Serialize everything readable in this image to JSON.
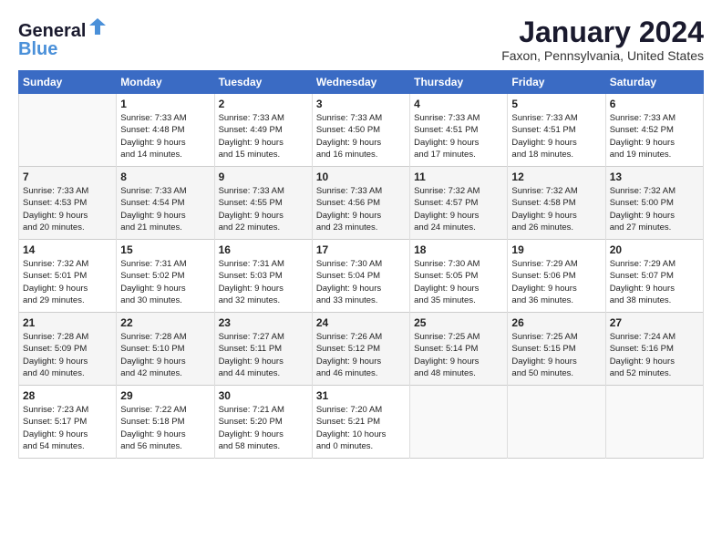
{
  "logo": {
    "line1": "General",
    "line2": "Blue"
  },
  "title": "January 2024",
  "subtitle": "Faxon, Pennsylvania, United States",
  "days_header": [
    "Sunday",
    "Monday",
    "Tuesday",
    "Wednesday",
    "Thursday",
    "Friday",
    "Saturday"
  ],
  "weeks": [
    [
      {
        "num": "",
        "info": ""
      },
      {
        "num": "1",
        "info": "Sunrise: 7:33 AM\nSunset: 4:48 PM\nDaylight: 9 hours\nand 14 minutes."
      },
      {
        "num": "2",
        "info": "Sunrise: 7:33 AM\nSunset: 4:49 PM\nDaylight: 9 hours\nand 15 minutes."
      },
      {
        "num": "3",
        "info": "Sunrise: 7:33 AM\nSunset: 4:50 PM\nDaylight: 9 hours\nand 16 minutes."
      },
      {
        "num": "4",
        "info": "Sunrise: 7:33 AM\nSunset: 4:51 PM\nDaylight: 9 hours\nand 17 minutes."
      },
      {
        "num": "5",
        "info": "Sunrise: 7:33 AM\nSunset: 4:51 PM\nDaylight: 9 hours\nand 18 minutes."
      },
      {
        "num": "6",
        "info": "Sunrise: 7:33 AM\nSunset: 4:52 PM\nDaylight: 9 hours\nand 19 minutes."
      }
    ],
    [
      {
        "num": "7",
        "info": "Sunrise: 7:33 AM\nSunset: 4:53 PM\nDaylight: 9 hours\nand 20 minutes."
      },
      {
        "num": "8",
        "info": "Sunrise: 7:33 AM\nSunset: 4:54 PM\nDaylight: 9 hours\nand 21 minutes."
      },
      {
        "num": "9",
        "info": "Sunrise: 7:33 AM\nSunset: 4:55 PM\nDaylight: 9 hours\nand 22 minutes."
      },
      {
        "num": "10",
        "info": "Sunrise: 7:33 AM\nSunset: 4:56 PM\nDaylight: 9 hours\nand 23 minutes."
      },
      {
        "num": "11",
        "info": "Sunrise: 7:32 AM\nSunset: 4:57 PM\nDaylight: 9 hours\nand 24 minutes."
      },
      {
        "num": "12",
        "info": "Sunrise: 7:32 AM\nSunset: 4:58 PM\nDaylight: 9 hours\nand 26 minutes."
      },
      {
        "num": "13",
        "info": "Sunrise: 7:32 AM\nSunset: 5:00 PM\nDaylight: 9 hours\nand 27 minutes."
      }
    ],
    [
      {
        "num": "14",
        "info": "Sunrise: 7:32 AM\nSunset: 5:01 PM\nDaylight: 9 hours\nand 29 minutes."
      },
      {
        "num": "15",
        "info": "Sunrise: 7:31 AM\nSunset: 5:02 PM\nDaylight: 9 hours\nand 30 minutes."
      },
      {
        "num": "16",
        "info": "Sunrise: 7:31 AM\nSunset: 5:03 PM\nDaylight: 9 hours\nand 32 minutes."
      },
      {
        "num": "17",
        "info": "Sunrise: 7:30 AM\nSunset: 5:04 PM\nDaylight: 9 hours\nand 33 minutes."
      },
      {
        "num": "18",
        "info": "Sunrise: 7:30 AM\nSunset: 5:05 PM\nDaylight: 9 hours\nand 35 minutes."
      },
      {
        "num": "19",
        "info": "Sunrise: 7:29 AM\nSunset: 5:06 PM\nDaylight: 9 hours\nand 36 minutes."
      },
      {
        "num": "20",
        "info": "Sunrise: 7:29 AM\nSunset: 5:07 PM\nDaylight: 9 hours\nand 38 minutes."
      }
    ],
    [
      {
        "num": "21",
        "info": "Sunrise: 7:28 AM\nSunset: 5:09 PM\nDaylight: 9 hours\nand 40 minutes."
      },
      {
        "num": "22",
        "info": "Sunrise: 7:28 AM\nSunset: 5:10 PM\nDaylight: 9 hours\nand 42 minutes."
      },
      {
        "num": "23",
        "info": "Sunrise: 7:27 AM\nSunset: 5:11 PM\nDaylight: 9 hours\nand 44 minutes."
      },
      {
        "num": "24",
        "info": "Sunrise: 7:26 AM\nSunset: 5:12 PM\nDaylight: 9 hours\nand 46 minutes."
      },
      {
        "num": "25",
        "info": "Sunrise: 7:25 AM\nSunset: 5:14 PM\nDaylight: 9 hours\nand 48 minutes."
      },
      {
        "num": "26",
        "info": "Sunrise: 7:25 AM\nSunset: 5:15 PM\nDaylight: 9 hours\nand 50 minutes."
      },
      {
        "num": "27",
        "info": "Sunrise: 7:24 AM\nSunset: 5:16 PM\nDaylight: 9 hours\nand 52 minutes."
      }
    ],
    [
      {
        "num": "28",
        "info": "Sunrise: 7:23 AM\nSunset: 5:17 PM\nDaylight: 9 hours\nand 54 minutes."
      },
      {
        "num": "29",
        "info": "Sunrise: 7:22 AM\nSunset: 5:18 PM\nDaylight: 9 hours\nand 56 minutes."
      },
      {
        "num": "30",
        "info": "Sunrise: 7:21 AM\nSunset: 5:20 PM\nDaylight: 9 hours\nand 58 minutes."
      },
      {
        "num": "31",
        "info": "Sunrise: 7:20 AM\nSunset: 5:21 PM\nDaylight: 10 hours\nand 0 minutes."
      },
      {
        "num": "",
        "info": ""
      },
      {
        "num": "",
        "info": ""
      },
      {
        "num": "",
        "info": ""
      }
    ]
  ]
}
